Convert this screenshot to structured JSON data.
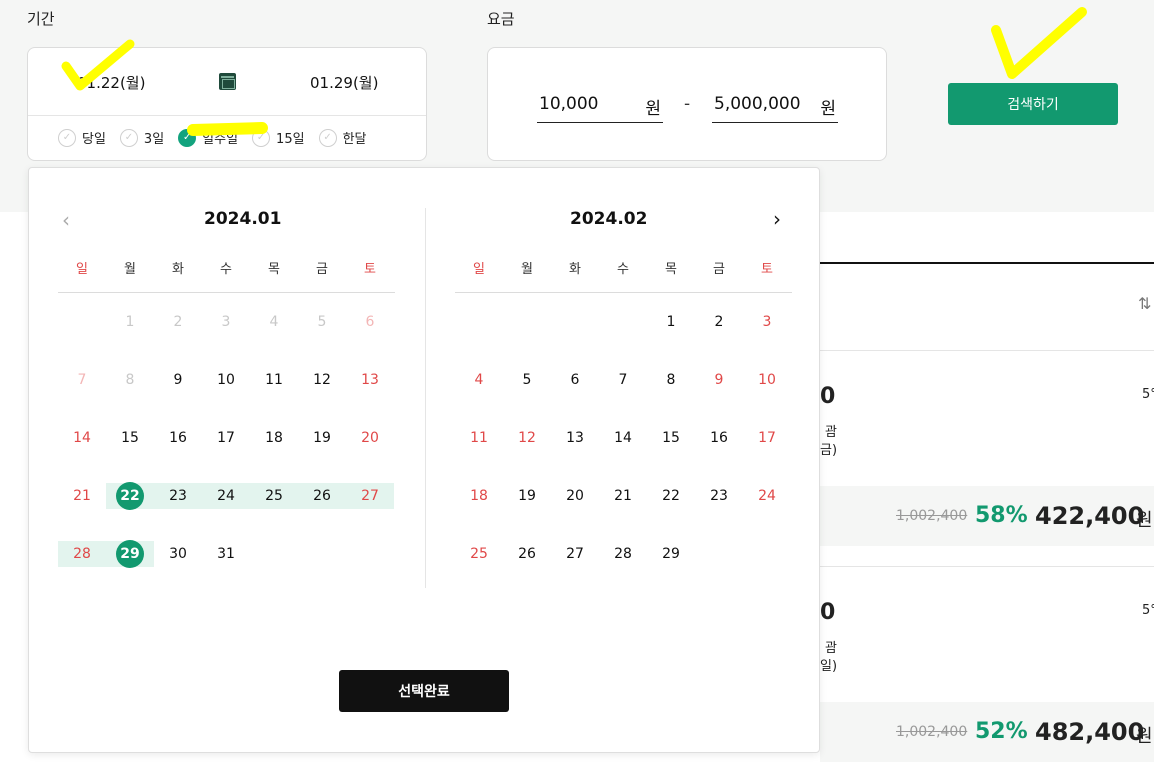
{
  "period": {
    "label": "기간",
    "start_date": "01.22(월)",
    "end_date": "01.29(월)",
    "quick_options": [
      {
        "label": "당일",
        "checked": false
      },
      {
        "label": "3일",
        "checked": false
      },
      {
        "label": "일주일",
        "checked": true
      },
      {
        "label": "15일",
        "checked": false
      },
      {
        "label": "한달",
        "checked": false
      }
    ]
  },
  "price": {
    "label": "요금",
    "min_value": "10,000",
    "max_value": "5,000,000",
    "unit": "원",
    "separator": "-"
  },
  "search_button": "검색하기",
  "calendar": {
    "weekdays": [
      "일",
      "월",
      "화",
      "수",
      "목",
      "금",
      "토"
    ],
    "months": [
      {
        "title": "2024.01",
        "weeks": [
          [
            "",
            "1",
            "2",
            "3",
            "4",
            "5",
            "6"
          ],
          [
            "7",
            "8",
            "9",
            "10",
            "11",
            "12",
            "13"
          ],
          [
            "14",
            "15",
            "16",
            "17",
            "18",
            "19",
            "20"
          ],
          [
            "21",
            "22",
            "23",
            "24",
            "25",
            "26",
            "27"
          ],
          [
            "28",
            "29",
            "30",
            "31",
            "",
            "",
            ""
          ]
        ],
        "disabled": [
          "1",
          "2",
          "3",
          "4",
          "5",
          "6",
          "7",
          "8"
        ],
        "red_extra": []
      },
      {
        "title": "2024.02",
        "weeks": [
          [
            "",
            "",
            "",
            "",
            "1",
            "2",
            "3"
          ],
          [
            "4",
            "5",
            "6",
            "7",
            "8",
            "9",
            "10"
          ],
          [
            "11",
            "12",
            "13",
            "14",
            "15",
            "16",
            "17"
          ],
          [
            "18",
            "19",
            "20",
            "21",
            "22",
            "23",
            "24"
          ],
          [
            "25",
            "26",
            "27",
            "28",
            "29",
            "",
            ""
          ]
        ],
        "disabled": [],
        "red_extra": [
          "9",
          "12"
        ]
      }
    ],
    "range_start": "22",
    "range_end": "29",
    "confirm_button": "선택완료"
  },
  "results": {
    "sort_icon": "sort-arrows-icon",
    "items": [
      {
        "price_fragment": "0",
        "text_fragment_1": "괌",
        "text_fragment_2": "금)",
        "rating_fragment": "5°",
        "original_price": "1,002,400",
        "discount": "58%",
        "final_price": "422,400",
        "currency": "원"
      },
      {
        "price_fragment": "0",
        "text_fragment_1": "괌",
        "text_fragment_2": "일)",
        "rating_fragment": "5°",
        "original_price": "1,002,400",
        "discount": "52%",
        "final_price": "482,400",
        "currency": "원"
      }
    ]
  },
  "colors": {
    "accent": "#12996f",
    "holiday_red": "#e04848",
    "range_bg": "#e3f4ee",
    "highlight": "#ffff00"
  }
}
